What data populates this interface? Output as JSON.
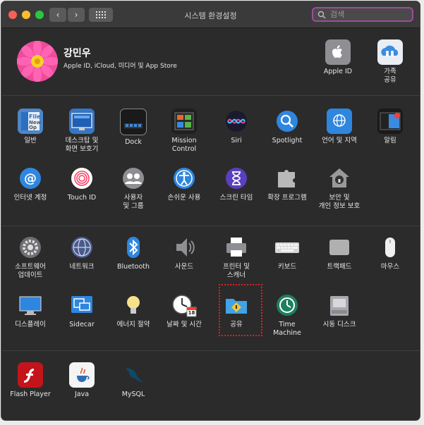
{
  "window": {
    "title": "시스템 환경설정",
    "search_placeholder": "검색"
  },
  "user": {
    "name": "강민우",
    "subtitle": "Apple ID, iCloud, 미디어 및 App Store"
  },
  "top_right": [
    {
      "id": "apple-id",
      "label": "Apple ID"
    },
    {
      "id": "family-sharing",
      "label": "가족\n공유"
    }
  ],
  "row1": [
    {
      "id": "general",
      "label": "일반"
    },
    {
      "id": "desktop-screensaver",
      "label": "데스크탑 및\n화면 보호기"
    },
    {
      "id": "dock",
      "label": "Dock"
    },
    {
      "id": "mission-control",
      "label": "Mission\nControl"
    },
    {
      "id": "siri",
      "label": "Siri"
    },
    {
      "id": "spotlight",
      "label": "Spotlight"
    },
    {
      "id": "language-region",
      "label": "언어 및 지역"
    },
    {
      "id": "notifications",
      "label": "알림"
    }
  ],
  "row2": [
    {
      "id": "internet-accounts",
      "label": "인터넷 계정"
    },
    {
      "id": "touch-id",
      "label": "Touch ID"
    },
    {
      "id": "users-groups",
      "label": "사용자\n및 그룹"
    },
    {
      "id": "accessibility",
      "label": "손쉬운 사용"
    },
    {
      "id": "screen-time",
      "label": "스크린 타임"
    },
    {
      "id": "extensions",
      "label": "확장 프로그램"
    },
    {
      "id": "security-privacy",
      "label": "보안 및\n개인 정보 보호"
    }
  ],
  "row3": [
    {
      "id": "software-update",
      "label": "소프트웨어\n업데이트"
    },
    {
      "id": "network",
      "label": "네트워크"
    },
    {
      "id": "bluetooth",
      "label": "Bluetooth"
    },
    {
      "id": "sound",
      "label": "사운드"
    },
    {
      "id": "printers-scanners",
      "label": "프린터 및\n스캐너"
    },
    {
      "id": "keyboard",
      "label": "키보드"
    },
    {
      "id": "trackpad",
      "label": "트랙패드"
    },
    {
      "id": "mouse",
      "label": "마우스"
    }
  ],
  "row4": [
    {
      "id": "displays",
      "label": "디스플레이"
    },
    {
      "id": "sidecar",
      "label": "Sidecar"
    },
    {
      "id": "energy-saver",
      "label": "에너지 절약"
    },
    {
      "id": "date-time",
      "label": "날짜 및 시간"
    },
    {
      "id": "sharing",
      "label": "공유"
    },
    {
      "id": "time-machine",
      "label": "Time\nMachine"
    },
    {
      "id": "startup-disk",
      "label": "시동 디스크"
    }
  ],
  "row5": [
    {
      "id": "flash-player",
      "label": "Flash Player"
    },
    {
      "id": "java",
      "label": "Java"
    },
    {
      "id": "mysql",
      "label": "MySQL"
    }
  ],
  "calendar_icon_day": "18"
}
